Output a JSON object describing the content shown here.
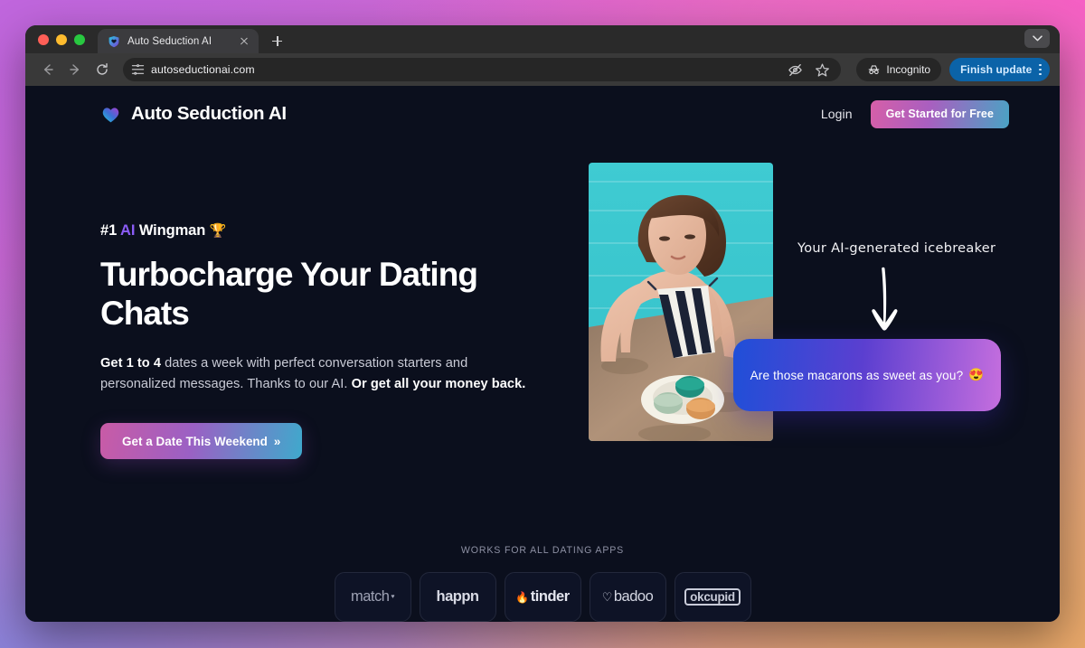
{
  "browser": {
    "tab": {
      "title": "Auto Seduction AI",
      "favicon_icon": "shield-heart-icon"
    },
    "newtab_label": "+",
    "toolbar": {
      "back_icon": "arrow-left-icon",
      "forward_icon": "arrow-right-icon",
      "reload_icon": "reload-icon",
      "site_settings_icon": "tune-sliders-icon",
      "url": "autoseductionai.com",
      "hide_icon": "eye-crossed-icon",
      "bookmark_icon": "star-icon",
      "incognito_label": "Incognito",
      "incognito_icon": "incognito-hat-icon",
      "update_label": "Finish update",
      "menu_icon": "kebab-menu-icon"
    },
    "tab_list_icon": "chevron-down-icon"
  },
  "site": {
    "header": {
      "logo_icon": "gradient-heart-icon",
      "brand": "Auto Seduction AI",
      "login": "Login",
      "cta": "Get Started for Free"
    },
    "hero": {
      "eyebrow_pre": "#1 ",
      "eyebrow_ai": "AI",
      "eyebrow_post": " Wingman ",
      "eyebrow_emoji": "🏆",
      "headline": "Turbocharge Your Dating Chats",
      "sub_bold_1": "Get 1 to 4",
      "sub_mid": " dates a week with perfect conversation starters and personalized messages. Thanks to our AI. ",
      "sub_bold_2": "Or get all your money back.",
      "cta": "Get a Date This Weekend",
      "cta_chevron": "»",
      "photo_alt": "woman-in-striped-swimsuit-by-pool-with-macarons",
      "annotation": "Your AI-generated icebreaker",
      "arrow_icon": "hand-drawn-down-arrow-icon",
      "bubble_text": "Are those macarons as sweet as you?",
      "bubble_emoji": "😍"
    },
    "logos": {
      "label": "WORKS FOR ALL DATING APPS",
      "items": [
        {
          "name": "match",
          "mark": "♥"
        },
        {
          "name": "happn",
          "mark": ""
        },
        {
          "name": "tinder",
          "mark": "🔥"
        },
        {
          "name": "badoo",
          "mark": "♡"
        },
        {
          "name": "okcupid",
          "mark": ""
        }
      ]
    }
  },
  "colors": {
    "page_bg": "#0b0f1d",
    "accent_purple": "#8b5cf6",
    "cta_gradient_from": "#d65fa8",
    "cta_gradient_to": "#4aa3c4",
    "bubble_from": "#1f4fd8",
    "bubble_to": "#c56ede",
    "update_pill": "#0b63a8"
  }
}
